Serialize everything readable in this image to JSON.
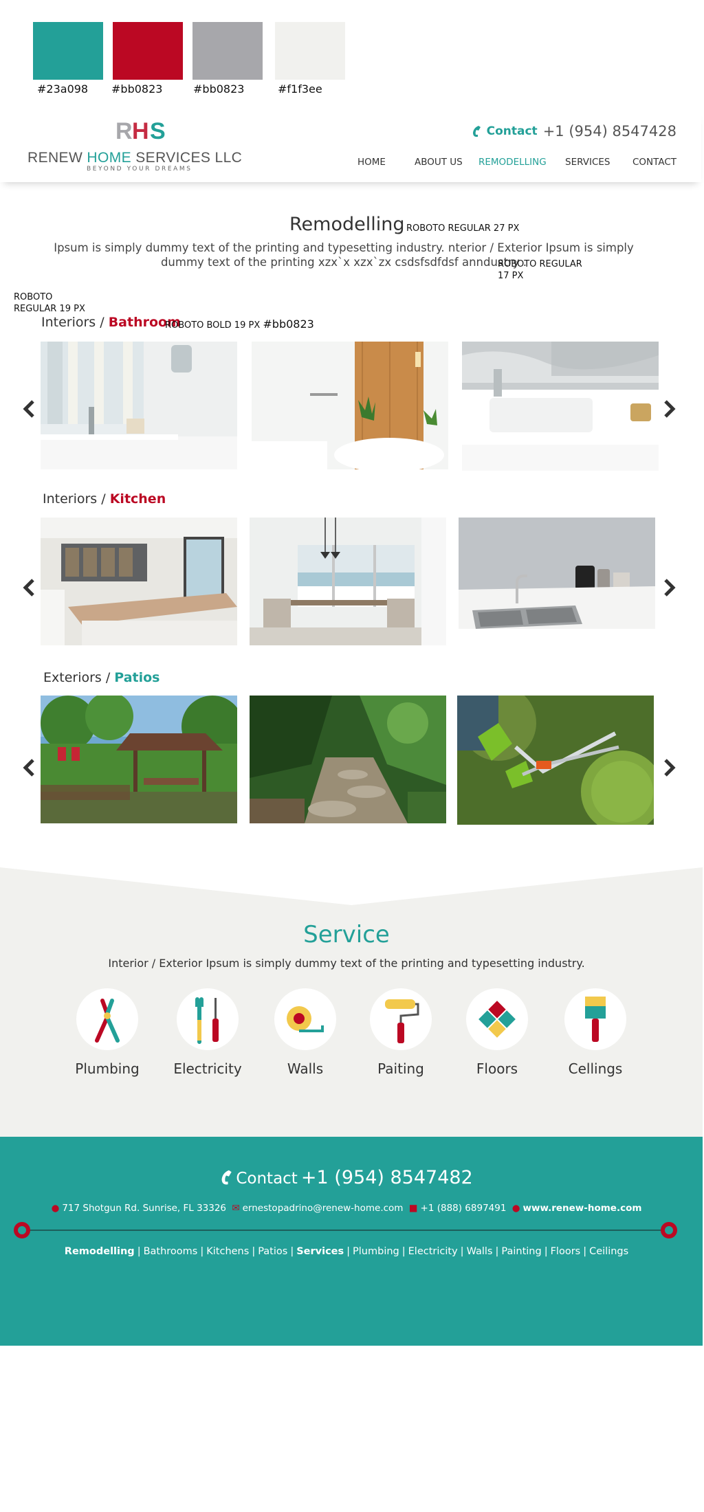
{
  "swatches": [
    {
      "color": "#23a098",
      "label": "#23a098"
    },
    {
      "color": "#bb0823",
      "label": "#bb0823"
    },
    {
      "color": "#a7a7ab",
      "label": "#bb0823"
    },
    {
      "color": "#f1f1ee",
      "label": "#f1f3ee"
    }
  ],
  "header": {
    "logo_mark": "RHS",
    "logo_name_a": "RENEW ",
    "logo_name_b": "HOME",
    "logo_name_c": " SERVICES LLC",
    "logo_tagline": "BEYOND YOUR DREAMS",
    "contact_label": "Contact",
    "phone": "+1 (954) 8547428",
    "nav": [
      "HOME",
      "ABOUT US",
      "REMODELLING",
      "SERVICES",
      "CONTACT"
    ],
    "active_nav": "REMODELLING"
  },
  "main": {
    "title": "Remodelling",
    "title_note": "ROBOTO REGULAR 27 PX",
    "intro": "Ipsum is simply dummy text of the printing and typesetting industry. nterior / Exterior Ipsum is simply dummy text of the printing  xzx`x xzx`zx csdsfsdfdsf anndustry .",
    "intro_note_1": "ROBOTO REGULAR",
    "intro_note_2": "17 PX",
    "side_note_1": "ROBOTO",
    "side_note_2": "REGULAR 19 PX",
    "section_note": "ROBOTO BOLD 19 PX",
    "section_note_color": "#bb0823",
    "sections": [
      {
        "prefix": "Interiors / ",
        "name": "Bathroom",
        "images": [
          "bathroom-vanity-photo",
          "bathroom-wood-wall-photo",
          "bathroom-sink-photo"
        ]
      },
      {
        "prefix": "Interiors / ",
        "name": "Kitchen",
        "images": [
          "kitchen-island-photo",
          "dining-room-photo",
          "kitchen-sink-photo"
        ]
      },
      {
        "prefix": "Exteriors / ",
        "name": "Patios",
        "images": [
          "garden-gazebo-photo",
          "garden-path-photo",
          "hedge-trimming-photo"
        ]
      }
    ],
    "arrows": {
      "prev": "chevron-left-icon",
      "next": "chevron-right-icon"
    }
  },
  "service": {
    "title": "Service",
    "subtitle": "Interior / Exterior Ipsum is simply dummy text of the printing and typesetting industry.",
    "items": [
      {
        "label": "Plumbing",
        "icon": "pliers-icon"
      },
      {
        "label": "Electricity",
        "icon": "wrench-screwdriver-icon"
      },
      {
        "label": "Walls",
        "icon": "tape-measure-icon"
      },
      {
        "label": "Paiting",
        "icon": "paint-roller-icon"
      },
      {
        "label": "Floors",
        "icon": "floor-tiles-icon"
      },
      {
        "label": "Cellings",
        "icon": "paint-brush-icon"
      }
    ]
  },
  "footer": {
    "contact_label": "Contact",
    "phone": "+1 (954) 8547482",
    "address": "717 Shotgun Rd. Sunrise, FL 33326",
    "email": "ernestopadrino@renew-home.com",
    "fax": "+1 (888) 6897491",
    "website": "www.renew-home.com",
    "links_a_title": "Remodelling",
    "links_a": [
      "Bathrooms",
      "Kitchens",
      "Patios"
    ],
    "links_b_title": "Services",
    "links_b": [
      "Plumbing",
      "Electricity",
      "Walls",
      "Painting",
      "Floors",
      "Ceilings"
    ]
  },
  "colors": {
    "teal": "#23a098",
    "red": "#bb0823",
    "gray": "#a7a7ab",
    "offwhite": "#f1f1ee"
  }
}
